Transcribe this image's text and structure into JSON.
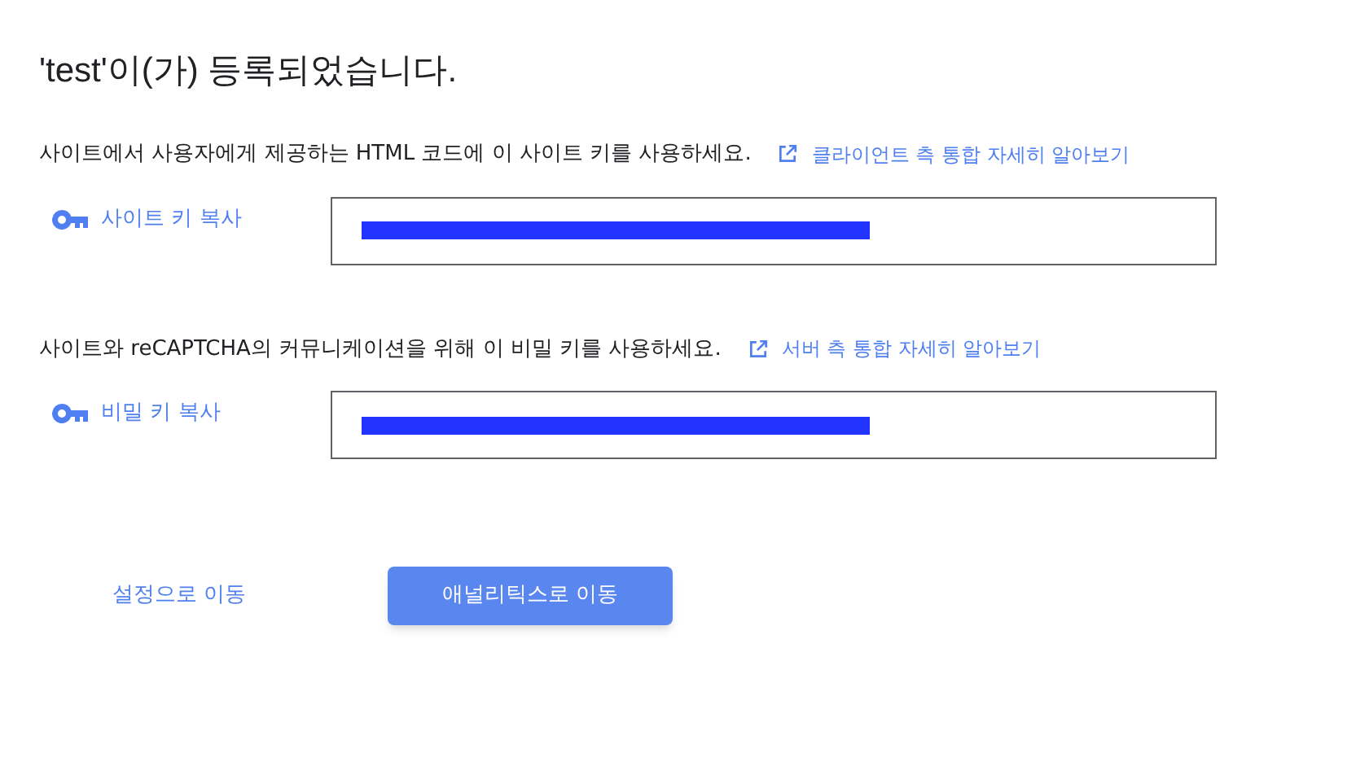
{
  "title": "'test'이(가) 등록되었습니다.",
  "sections": [
    {
      "description": "사이트에서 사용자에게 제공하는 HTML 코드에 이 사이트 키를 사용하세요.",
      "link": "클라이언트 측 통합 자세히 알아보기",
      "copy_label": "사이트 키 복사",
      "redacted": true
    },
    {
      "description": "사이트와 reCAPTCHA의 커뮤니케이션을 위해 이 비밀 키를 사용하세요.",
      "link": "서버 측 통합 자세히 알아보기",
      "copy_label": "비밀 키 복사",
      "redacted": true
    }
  ],
  "buttons": [
    {
      "label": "설정으로 이동",
      "kind": "text"
    },
    {
      "label": "애널리틱스로 이동",
      "kind": "primary"
    }
  ]
}
